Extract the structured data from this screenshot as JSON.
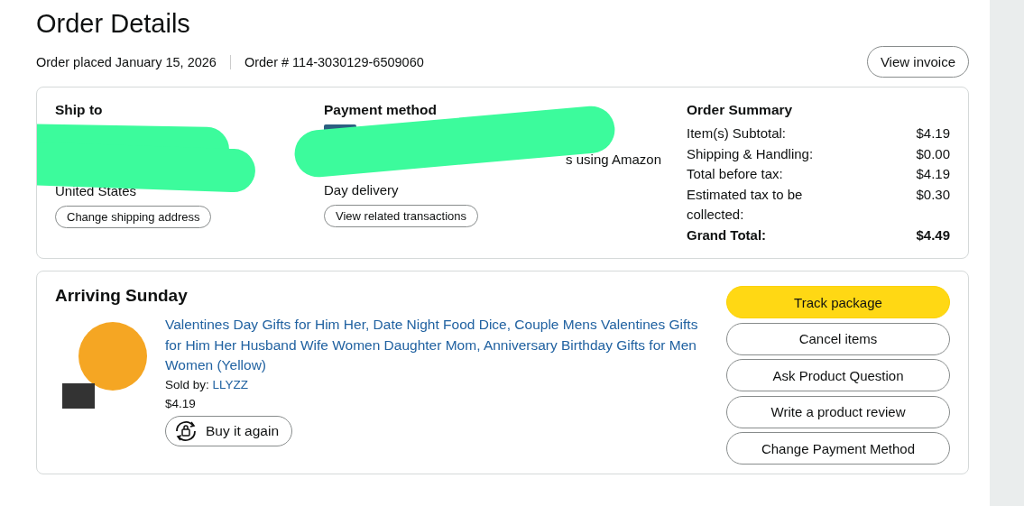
{
  "title": "Order Details",
  "order_placed": "Order placed January 15, 2026",
  "order_number": "Order # 114-3030129-6509060",
  "view_invoice": "View invoice",
  "ship_to": {
    "heading": "Ship to",
    "country": "United States",
    "button": "Change shipping address"
  },
  "payment": {
    "heading": "Payment method",
    "line_end": "s using Amazon",
    "line_last": "Day delivery",
    "button": "View related transactions"
  },
  "summary": {
    "heading": "Order Summary",
    "rows": [
      {
        "label": "Item(s) Subtotal:",
        "value": "$4.19",
        "kind": "normal"
      },
      {
        "label": "Shipping & Handling:",
        "value": "$0.00",
        "kind": "normal"
      },
      {
        "label": "Total before tax:",
        "value": "$4.19",
        "kind": "normal"
      },
      {
        "label": "Estimated tax to be collected:",
        "value": "$0.30",
        "kind": "normal"
      },
      {
        "label": "Grand Total:",
        "value": "$4.49",
        "kind": "total"
      }
    ]
  },
  "shipment": {
    "heading": "Arriving Sunday",
    "product": {
      "title": "Valentines Day Gifts for Him Her, Date Night Food Dice, Couple Mens Valentines Gifts for Him Her Husband Wife Women Daughter Mom, Anniversary Birthday Gifts for Men Women (Yellow)",
      "sold_by_label": "Sold by:",
      "seller": "LLYZZ",
      "price": "$4.19",
      "buy_again": "Buy it again"
    },
    "actions": [
      {
        "label": "Track package",
        "kind": "primary"
      },
      {
        "label": "Cancel items",
        "kind": "secondary"
      },
      {
        "label": "Ask Product Question",
        "kind": "secondary"
      },
      {
        "label": "Write a product review",
        "kind": "secondary"
      },
      {
        "label": "Change Payment Method",
        "kind": "secondary"
      }
    ]
  }
}
